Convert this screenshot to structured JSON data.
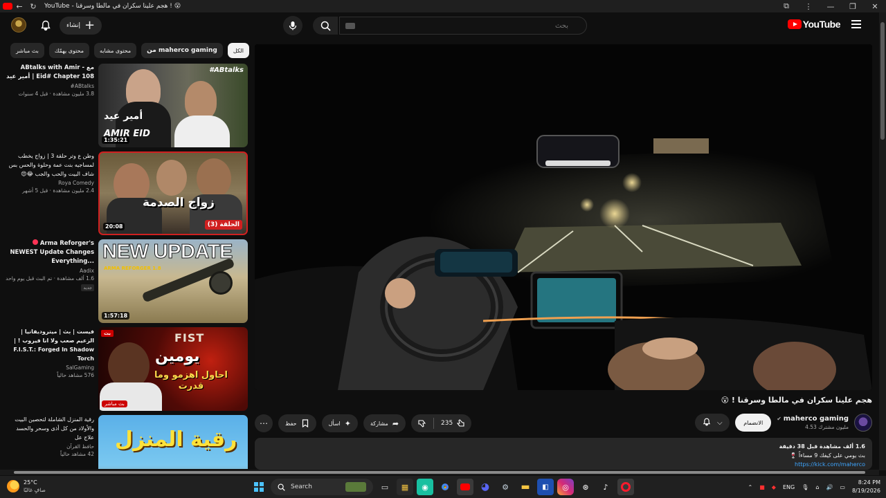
{
  "browser": {
    "tab_title": "YouTube - هجم علينا سكران في مالطا وسرقنا ! 😮"
  },
  "header": {
    "logo_text": "YouTube",
    "search_placeholder": "بحث",
    "create_label": "إنشاء"
  },
  "chips": [
    {
      "label": "الكل"
    },
    {
      "label": "من maherco gaming"
    },
    {
      "label": "محتوى مشابه"
    },
    {
      "label": "محتوى يهمّك"
    },
    {
      "label": "بث مباشر"
    }
  ],
  "recommendations": [
    {
      "title": "مع - ABtalks with Amir Eid# Chapter 108 | أمير عيد",
      "channel": "ABtalks#",
      "views": "3.8 مليون مشاهدة · قبل 4 سنوات",
      "duration": "1:35:21",
      "thumb_caption": "أمير عيد",
      "thumb_caption2": "AMIR EID",
      "thumb_tag": "#ABtalks"
    },
    {
      "title": "وطن ع وتر حلقة 3 | زواج يخطب لمساجيه بنت عمة وحلوة والحس بس شاف البيت والحب والجب 😂😍",
      "channel": "Roya Comedy",
      "views": "2.4 مليون مشاهدة · قبل 5 أشهر",
      "duration": "20:08",
      "thumb_caption": "زواج الصدمة",
      "thumb_caption2": "الحلقة (3)"
    },
    {
      "title": "Arma Reforger's NEWEST Update Changes Everything...",
      "channel": "Aadix",
      "views": "1.6 ألف مشاهدة · تم البث قبل يوم واحد",
      "new_tag": "جديد",
      "duration": "1:57:18",
      "thumb_caption": "NEW UPDATE",
      "thumb_caption2": "ARMA REFORGER 1.8"
    },
    {
      "title": "فيست | بث | ميتروديفانيا | الزعيم صعب ولا انا فيروب ! | F.I.S.T.: Forged In Shadow Torch",
      "channel": "SalGaming",
      "views": "576 مشاهد حالياً",
      "live_label": "بث مباشر",
      "thumb_caption": "يومين",
      "thumb_caption2": "احاول اهزمو وما قدرت",
      "thumb_caption3": "FIST",
      "thumb_live": "بث"
    },
    {
      "title": "رقية المنزل الشاملة لتحصين البيت والأولاد من كل أذى وسحر والحسد علاج عل",
      "channel": "حافظ القرآن",
      "views": "42 مشاهد حالياً",
      "thumb_caption": "رقية المنزل"
    }
  ],
  "video": {
    "title": "هجم علينا سكران في مالطا وسرقنا ! 😮",
    "channel_name": "maherco gaming",
    "subscribers": "4.53 مليون مشترك",
    "join_label": "الانضمام",
    "likes": "235",
    "share_label": "مشاركة",
    "ask_label": "اسأل",
    "save_label": "حفظ",
    "description_line1_bold": "1.6 ألف مشاهدة قبل 38 دقيقة",
    "description_line2": "بث يومي على كيفك 9 مساءاً 🍷",
    "description_link": "https://kick.com/maherco"
  },
  "taskbar": {
    "temperature": "25°C",
    "weather_desc": "صافٍ غالبًا",
    "search_label": "Search",
    "language": "ENG",
    "time": "8:24 PM",
    "date": "8/19/2026"
  },
  "colors": {
    "background": "#0f0f0f",
    "surface": "#272727",
    "brand_red": "#ff0000",
    "link": "#3ea6ff"
  }
}
